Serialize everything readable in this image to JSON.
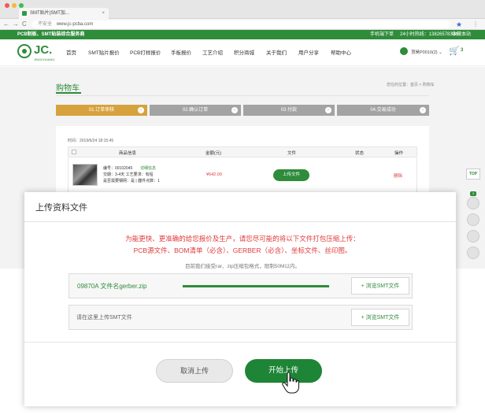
{
  "browser": {
    "tab_title": "SMT贴片|SMT加...",
    "tab_close": "×",
    "security": "不安全",
    "url": "www.jc-pcba.com",
    "back": "←",
    "forward": "→",
    "reload": "C",
    "star": "★",
    "menu": "⋮",
    "colors": {
      "close": "#f05a52",
      "minimize": "#f5b83a",
      "maximize": "#3cbf4a"
    }
  },
  "topbar": {
    "slogan": "PCB制板、SMT贴装综合服务商",
    "mobile_order": "手机端下单",
    "hotline": "24小时热线：13826578334",
    "favorite": "收藏本站"
  },
  "header": {
    "logo_text": "JC.",
    "logo_sub": "JINGCHUANG",
    "nav": [
      "首页",
      "SMT贴片报价",
      "PCB打样报价",
      "手板报价",
      "工艺介绍",
      "积分商城",
      "关于我们",
      "用户分享",
      "帮助中心"
    ],
    "user_name": "顶昊P0010(2) ⌄",
    "cart_count": "3",
    "cart_icon": "cart-icon"
  },
  "cart": {
    "title": "购物车",
    "breadcrumb": "您在的位置：首页 > 购物车",
    "steps": [
      {
        "label": "01.订单审核",
        "icon": "›"
      },
      {
        "label": "02.确认订单",
        "icon": "›"
      },
      {
        "label": "03.付款",
        "icon": "›"
      },
      {
        "label": "04.交易成功",
        "icon": "›"
      }
    ],
    "order_time": "时间：2019/6/24 18:15:45",
    "headers": [
      "商品信息",
      "金额(元)",
      "文件",
      "状态",
      "操作"
    ],
    "item": {
      "code": "编号：00102045",
      "detail_link": "详细信息",
      "line2": "交期：3-4天  工艺要求：有铅",
      "line3": "是否需要钢网：是  |  器件点数：1",
      "price": "¥642.00",
      "upload_btn": "上传文件",
      "delete": "删除"
    }
  },
  "sidebar": {
    "top_label": "TOP",
    "badge": "3"
  },
  "dialog": {
    "title": "上传资料文件",
    "notice_line1": "为能更快、更准确的给您报价及生产，请您尽可能的将以下文件打包压缩上传：",
    "notice_line2": "PCB源文件、BOM清单（必含）、GERBER（必含）、坐标文件、丝印图。",
    "notice_sub": "目前我们接受rar、zip压缩包格式，限制50M以内。",
    "file_name": "09870A   文件名gerber.zip",
    "browse_label": "+ 浏览SMT文件",
    "placeholder": "请在这里上传SMT文件",
    "cancel_label": "取消上传",
    "start_label": "开始上传",
    "upload_progress": 1.0
  }
}
